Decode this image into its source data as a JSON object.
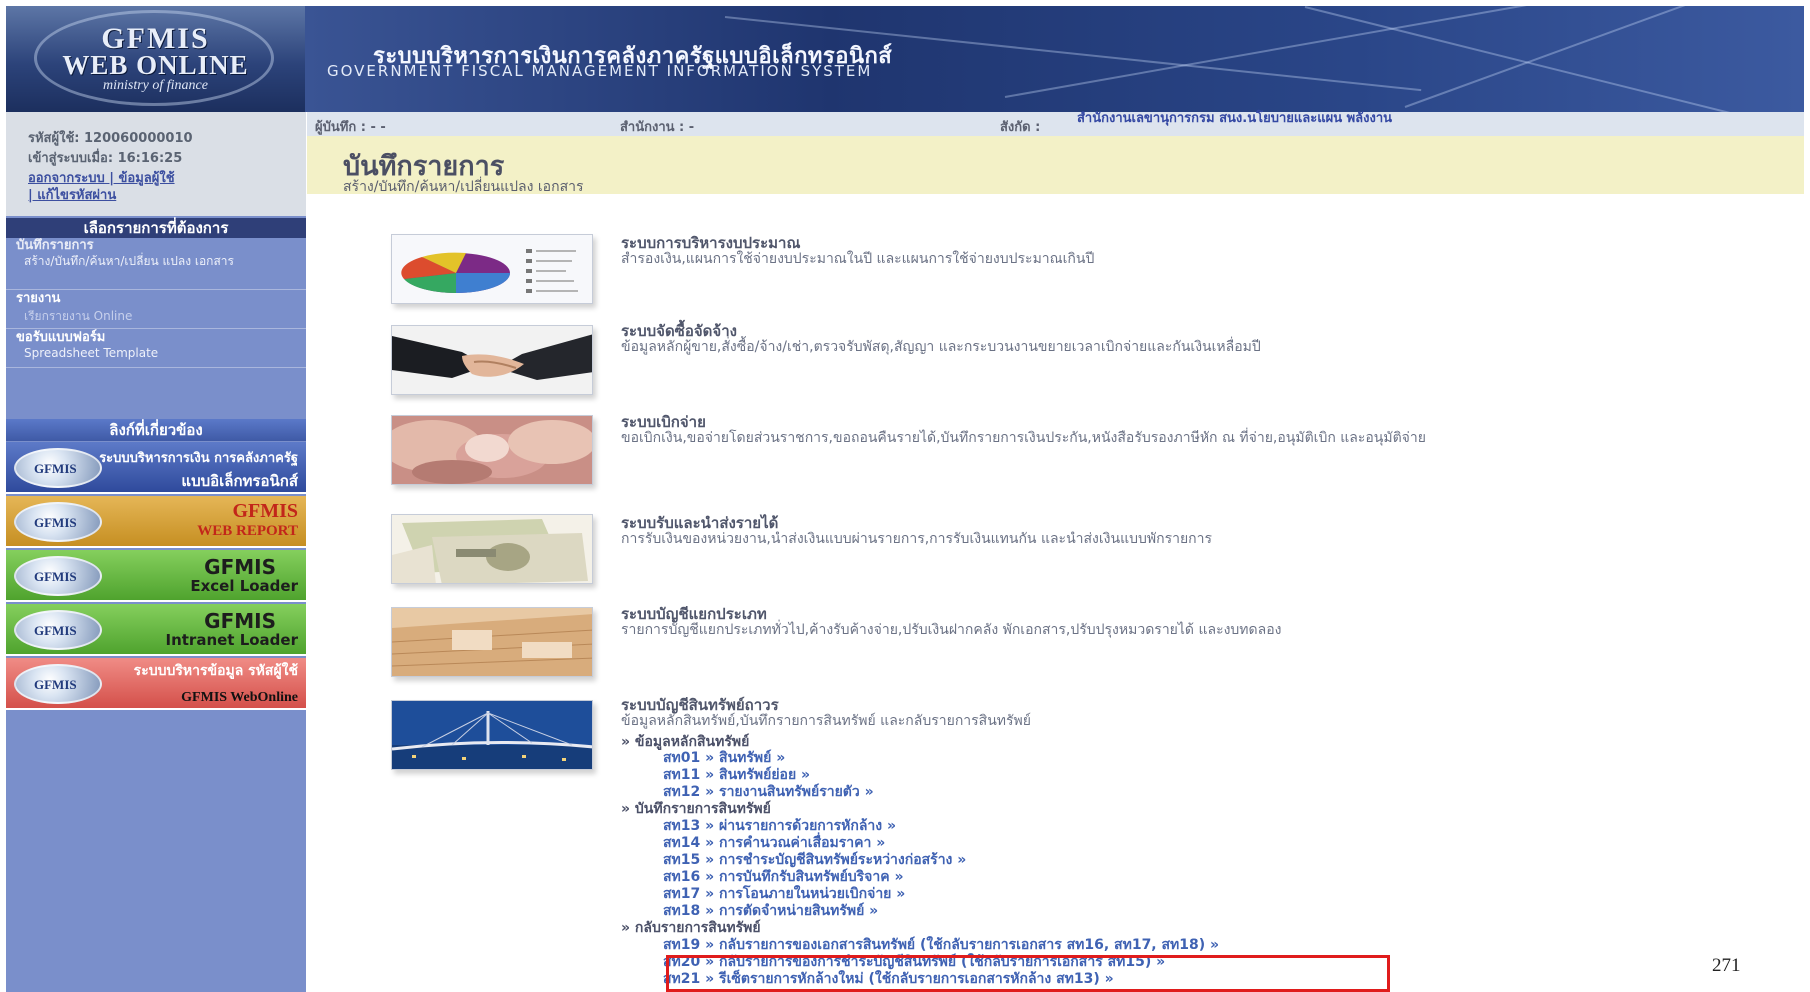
{
  "header": {
    "logo_line1": "GFMIS",
    "logo_line2": "WEB ONLINE",
    "logo_line3": "ministry of finance",
    "title_th": "ระบบบริหารการเงินการคลังภาครัฐแบบอิเล็กทรอนิกส์",
    "title_en": "GOVERNMENT FISCAL MANAGEMENT INFORMATION SYSTEM"
  },
  "user": {
    "id_label": "รหัสผู้ใช้: 120060000010",
    "login_label": "เข้าสู่ระบบเมื่อ: 16:16:25",
    "links_line1": "ออกจากระบบ | ข้อมูลผู้ใช้",
    "links_line2": "| แก้ไขรหัสผ่าน"
  },
  "sidebar": {
    "section_title": "เลือกรายการที่ต้องการ",
    "items": [
      {
        "title": "บันทึกรายการ",
        "sub": "สร้าง/บันทึก/ค้นหา/เปลี่ยน แปลง เอกสาร"
      },
      {
        "title": "รายงาน",
        "sub": "เรียกรายงาน Online"
      },
      {
        "title": "ขอรับแบบฟอร์ม",
        "sub": "Spreadsheet Template"
      }
    ],
    "links_title": "ลิงก์ที่เกี่ยวข้อง",
    "systems": [
      {
        "badge": "GFMIS",
        "line1": "ระบบบริหารการเงิน การคลังภาครัฐ",
        "line2": "แบบอิเล็กทรอนิกส์",
        "bg": "#3c5ab0",
        "fg": "#ffffff"
      },
      {
        "badge": "GFMIS",
        "line1": "GFMIS",
        "line2": "WEB REPORT",
        "bg": "#d8a33a",
        "fg": "#c2261a"
      },
      {
        "badge": "GFMIS",
        "line1": "GFMIS",
        "line2": "Excel Loader",
        "bg": "#6ebd45",
        "fg": "#1d1d1d"
      },
      {
        "badge": "GFMIS",
        "line1": "GFMIS",
        "line2": "Intranet Loader",
        "bg": "#6ebd45",
        "fg": "#1d1d1d"
      },
      {
        "badge": "GFMIS",
        "line1": "ระบบบริหารข้อมูล รหัสผู้ใช้",
        "line2": "GFMIS WebOnline",
        "bg": "#e46a64",
        "fg": "#ffffff"
      }
    ]
  },
  "topbar": {
    "recorder": "ผู้บันทึก : - -",
    "office": "สำนักงาน : -",
    "affiliation_label": "สังกัด :",
    "affiliation": "สำนักงานเลขานุการกรม สนง.นโยบายและแผน พลังงาน"
  },
  "page": {
    "title": "บันทึกรายการ",
    "subtitle": "สร้าง/บันทึก/ค้นหา/เปลี่ยนแปลง เอกสาร"
  },
  "modules": [
    {
      "title": "ระบบการบริหารงบประมาณ",
      "desc": "สำรองเงิน,แผนการใช้จ่ายงบประมาณในปี และแผนการใช้จ่ายงบประมาณเกินปี",
      "thumb": "pie-chart"
    },
    {
      "title": "ระบบจัดซื้อจัดจ้าง",
      "desc": "ข้อมูลหลักผู้ขาย,สั่งซื้อ/จ้าง/เช่า,ตรวจรับพัสดุ,สัญญา และกระบวนงานขยายเวลาเบิกจ่ายและกันเงินเหลื่อมปี",
      "thumb": "handshake"
    },
    {
      "title": "ระบบเบิกจ่าย",
      "desc": "ขอเบิกเงิน,ขอจ่ายโดยส่วนราชการ,ขอถอนคืนรายได้,บันทึกรายการเงินประกัน,หนังสือรับรองภาษีหัก ณ ที่จ่าย,อนุมัติเบิก และอนุมัติจ่าย",
      "thumb": "banknotes"
    },
    {
      "title": "ระบบรับและนำส่งรายได้",
      "desc": "การรับเงินของหน่วยงาน,นำส่งเงินแบบผ่านรายการ,การรับเงินแทนกัน และนำส่งเงินแบบพักรายการ",
      "thumb": "banknotes-green"
    },
    {
      "title": "ระบบบัญชีแยกประเภท",
      "desc": "รายการบัญชีแยกประเภททั่วไป,ค้างรับค้างจ่าย,ปรับเงินฝากคลัง พักเอกสาร,ปรับปรุงหมวดรายได้ และงบทดลอง",
      "thumb": "ledger"
    },
    {
      "title": "ระบบบัญชีสินทรัพย์ถาวร",
      "desc": "ข้อมูลหลักสินทรัพย์,บันทึกรายการสินทรัพย์ และกลับรายการสินทรัพย์",
      "thumb": "bridge"
    }
  ],
  "asset_tree": [
    {
      "group": "» ข้อมูลหลักสินทรัพย์",
      "items": [
        "สท01 » สินทรัพย์ »",
        "สท11 » สินทรัพย์ย่อย »",
        "สท12 » รายงานสินทรัพย์รายตัว »"
      ]
    },
    {
      "group": "» บันทึกรายการสินทรัพย์",
      "items": [
        "สท13 » ผ่านรายการด้วยการหักล้าง »",
        "สท14 » การคำนวณค่าเสื่อมราคา »",
        "สท15 » การชำระบัญชีสินทรัพย์ระหว่างก่อสร้าง »",
        "สท16 » การบันทึกรับสินทรัพย์บริจาค »",
        "สท17 » การโอนภายในหน่วยเบิกจ่าย »",
        "สท18 » การตัดจำหน่ายสินทรัพย์ »"
      ]
    },
    {
      "group": "» กลับรายการสินทรัพย์",
      "items": [
        "สท19 » กลับรายการของเอกสารสินทรัพย์ (ใช้กลับรายการเอกสาร สท16, สท17, สท18) »",
        "สท20 » กลับรายการของการชำระบัญชีสินทรัพย์ (ใช้กลับรายการเอกสาร สท15) »",
        "สท21 » รีเซ็ตรายการหักล้างใหม่ (ใช้กลับรายการเอกสารหักล้าง สท13) »"
      ]
    }
  ],
  "page_number": "271",
  "colors": {
    "highlight": "#e01c1c",
    "link": "#3f62b3",
    "sidebar": "#7a8fcb",
    "titlebar": "#f3f1c7"
  }
}
